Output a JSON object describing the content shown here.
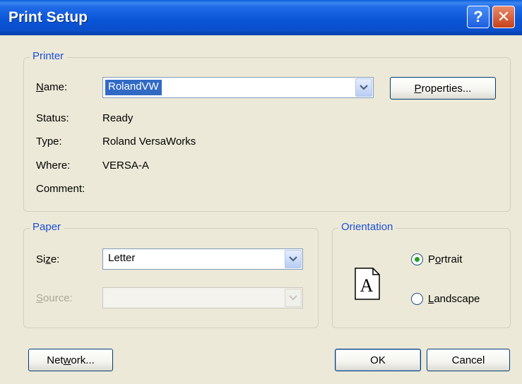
{
  "window": {
    "title": "Print Setup"
  },
  "titlebar": {
    "help_symbol": "?",
    "close_symbol": "✕"
  },
  "printer": {
    "legend": "Printer",
    "name_label": "Name:",
    "name_value": "RolandVW",
    "properties_label": "Properties...",
    "status_label": "Status:",
    "status_value": "Ready",
    "type_label": "Type:",
    "type_value": "Roland VersaWorks",
    "where_label": "Where:",
    "where_value": "VERSA-A",
    "comment_label": "Comment:",
    "comment_value": ""
  },
  "paper": {
    "legend": "Paper",
    "size_label": "Size:",
    "size_value": "Letter",
    "source_label": "Source:",
    "source_value": ""
  },
  "orientation": {
    "legend": "Orientation",
    "icon_letter": "A",
    "portrait_label": "Portrait",
    "landscape_label": "Landscape",
    "selected": "Portrait"
  },
  "footer": {
    "network_label": "Network...",
    "ok_label": "OK",
    "cancel_label": "Cancel"
  },
  "colors": {
    "titlebar": "#0a54d6",
    "legend": "#1c4fd6",
    "selection": "#316ac5",
    "face": "#ece9d8"
  }
}
